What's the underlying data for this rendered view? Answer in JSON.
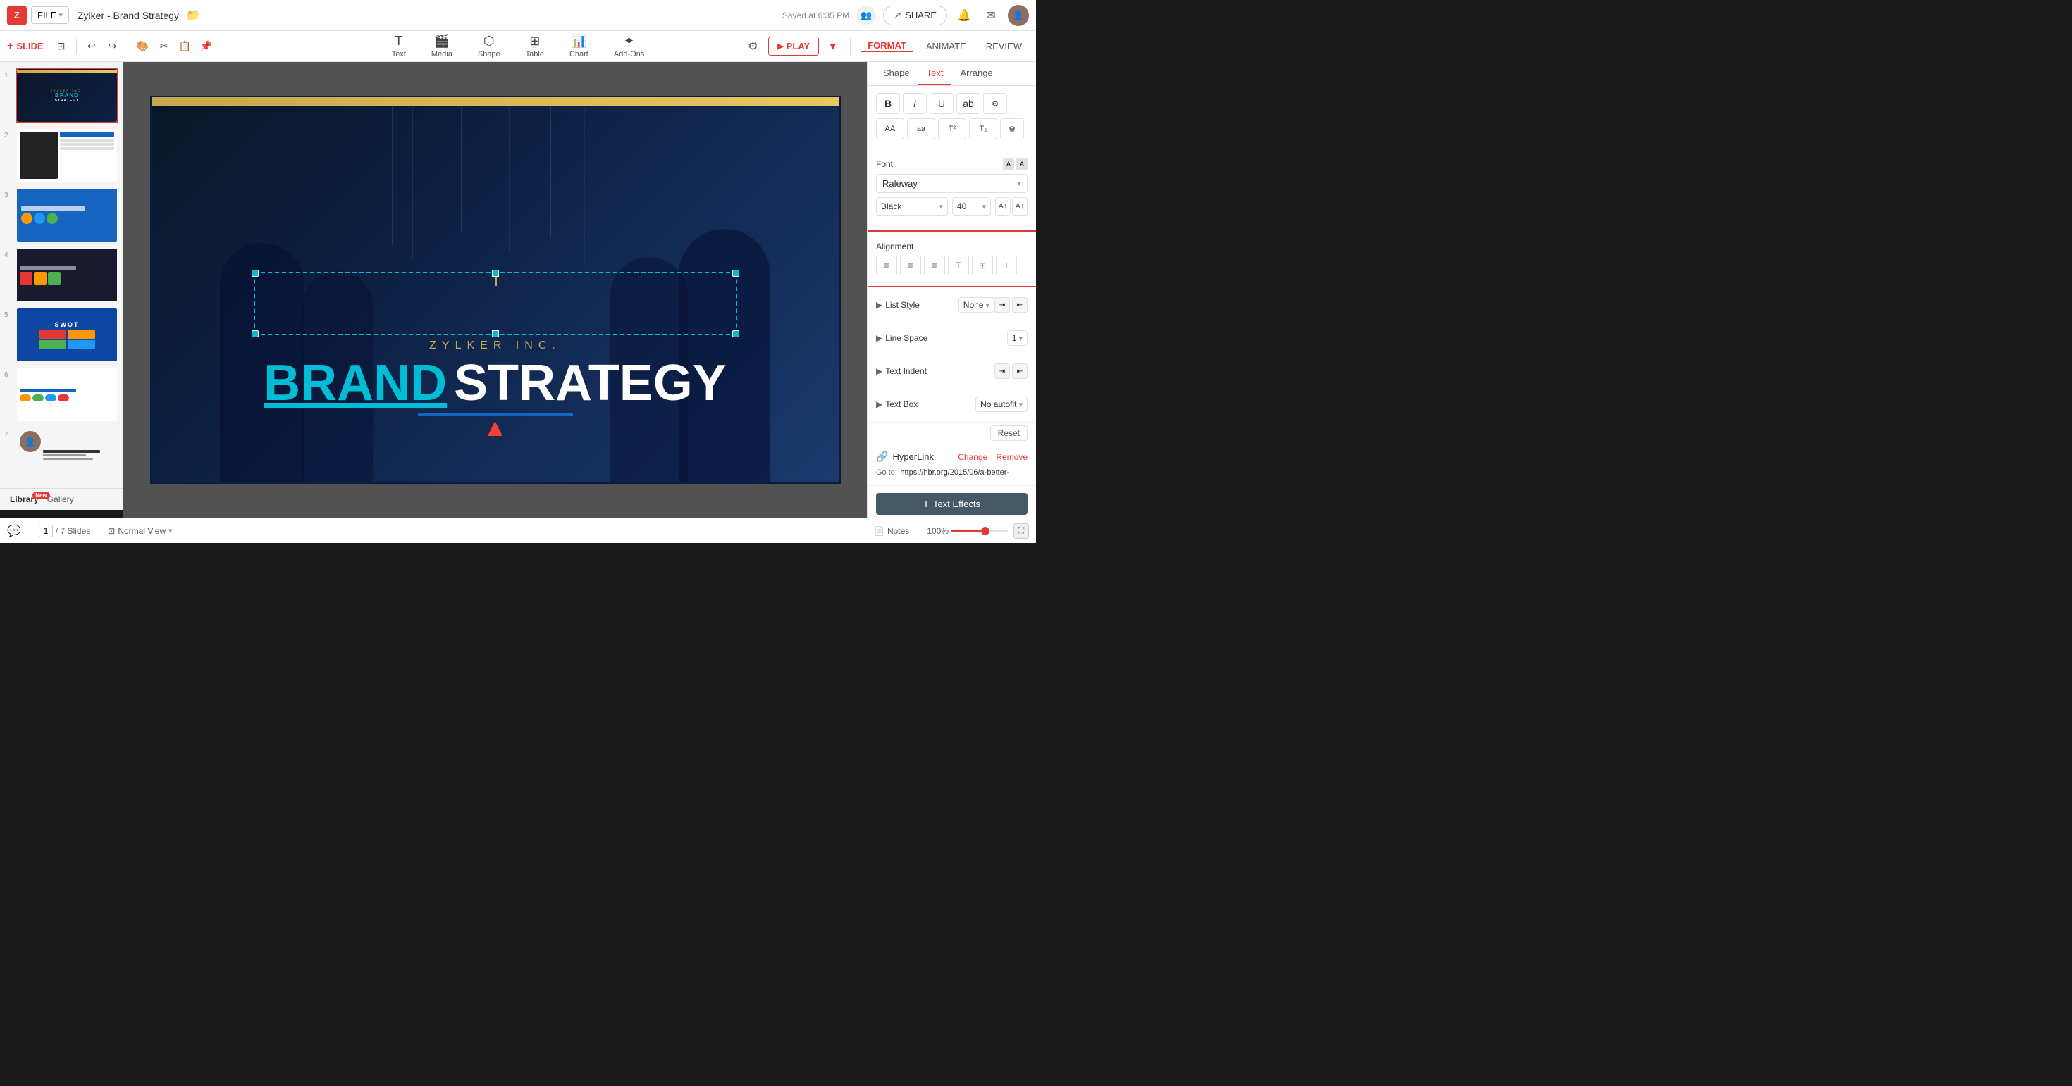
{
  "app": {
    "logo": "Z",
    "file_btn": "FILE",
    "doc_title": "Zylker - Brand Strategy",
    "saved_text": "Saved at 6:35 PM",
    "share_label": "SHARE"
  },
  "toolbar": {
    "slide_btn": "SLIDE",
    "tools": [
      {
        "id": "text",
        "icon": "T",
        "label": "Text"
      },
      {
        "id": "media",
        "icon": "🎬",
        "label": "Media"
      },
      {
        "id": "shape",
        "icon": "⬡",
        "label": "Shape"
      },
      {
        "id": "table",
        "icon": "⊞",
        "label": "Table"
      },
      {
        "id": "chart",
        "icon": "📊",
        "label": "Chart"
      },
      {
        "id": "addons",
        "icon": "✦",
        "label": "Add-Ons"
      }
    ],
    "play_label": "PLAY",
    "format_tab": "FORMAT",
    "animate_tab": "ANIMATE",
    "review_tab": "REVIEW"
  },
  "slides": [
    {
      "num": 1,
      "type": "brand_strategy"
    },
    {
      "num": 2,
      "type": "marketing"
    },
    {
      "num": 3,
      "type": "ways"
    },
    {
      "num": 4,
      "type": "digital"
    },
    {
      "num": 5,
      "type": "swot"
    },
    {
      "num": 6,
      "type": "btoc"
    },
    {
      "num": 7,
      "type": "person"
    }
  ],
  "slide_content": {
    "company": "ZYLKER INC.",
    "brand_word": "BRAND",
    "strategy_word": "STRATEGY"
  },
  "right_panel": {
    "tabs": [
      {
        "id": "shape",
        "label": "Shape"
      },
      {
        "id": "text",
        "label": "Text",
        "active": true
      },
      {
        "id": "arrange",
        "label": "Arrange"
      }
    ],
    "font": {
      "label": "Font",
      "name": "Raleway",
      "color": "Black",
      "size": "40",
      "bold": "B",
      "italic": "I",
      "underline": "U",
      "strikethrough": "ab",
      "aa_upper": "AA",
      "aa_lower": "aa",
      "superscript": "T²",
      "subscript": "T₂"
    },
    "alignment": {
      "label": "Alignment"
    },
    "list_style": {
      "label": "List Style",
      "value": "None"
    },
    "line_space": {
      "label": "Line Space",
      "value": "1"
    },
    "text_indent": {
      "label": "Text Indent"
    },
    "text_box": {
      "label": "Text Box",
      "value": "No autofit"
    },
    "reset_label": "Reset",
    "hyperlink": {
      "label": "HyperLink",
      "change": "Change",
      "remove": "Remove",
      "go_to": "Go to:",
      "url": "https://hbr.org/2015/06/a-better-"
    },
    "text_effects_label": "Text Effects"
  },
  "bottom_bar": {
    "slide_current": "1",
    "slide_total": "/ 7 Slides",
    "view_label": "Normal View",
    "notes_label": "Notes",
    "zoom_level": "100%"
  },
  "library": {
    "label": "Library",
    "badge": "New",
    "gallery_label": "Gallery"
  }
}
